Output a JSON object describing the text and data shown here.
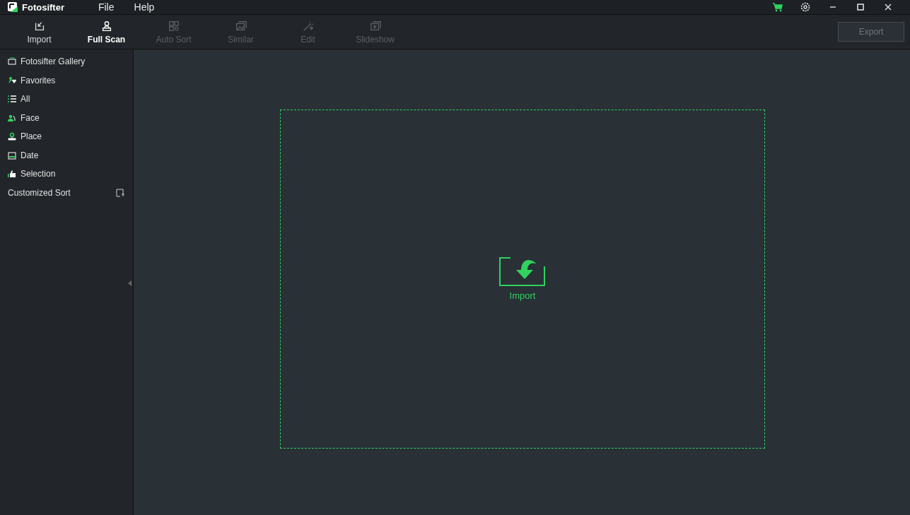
{
  "app": {
    "name": "Fotosifter"
  },
  "menu": [
    "File",
    "Help"
  ],
  "toolbar": [
    {
      "label": "Import",
      "kind": "import",
      "disabled": false,
      "selected": false
    },
    {
      "label": "Full Scan",
      "kind": "scan",
      "disabled": false,
      "selected": true
    },
    {
      "label": "Auto Sort",
      "kind": "autosort",
      "disabled": true,
      "selected": false
    },
    {
      "label": "Similar",
      "kind": "similar",
      "disabled": true,
      "selected": false
    },
    {
      "label": "Edit",
      "kind": "edit",
      "disabled": true,
      "selected": false
    },
    {
      "label": "Slideshow",
      "kind": "slideshow",
      "disabled": true,
      "selected": false
    }
  ],
  "export_button": {
    "label": "Export",
    "disabled": true
  },
  "sidebar": {
    "items": [
      {
        "label": "Fotosifter Gallery",
        "kind": "gallery"
      },
      {
        "label": "Favorites",
        "kind": "favorites"
      },
      {
        "label": "All",
        "kind": "all"
      },
      {
        "label": "Face",
        "kind": "face"
      },
      {
        "label": "Place",
        "kind": "place"
      },
      {
        "label": "Date",
        "kind": "date"
      },
      {
        "label": "Selection",
        "kind": "selection"
      }
    ],
    "custom_sort": "Customized Sort"
  },
  "drop_zone": {
    "label": "Import"
  }
}
